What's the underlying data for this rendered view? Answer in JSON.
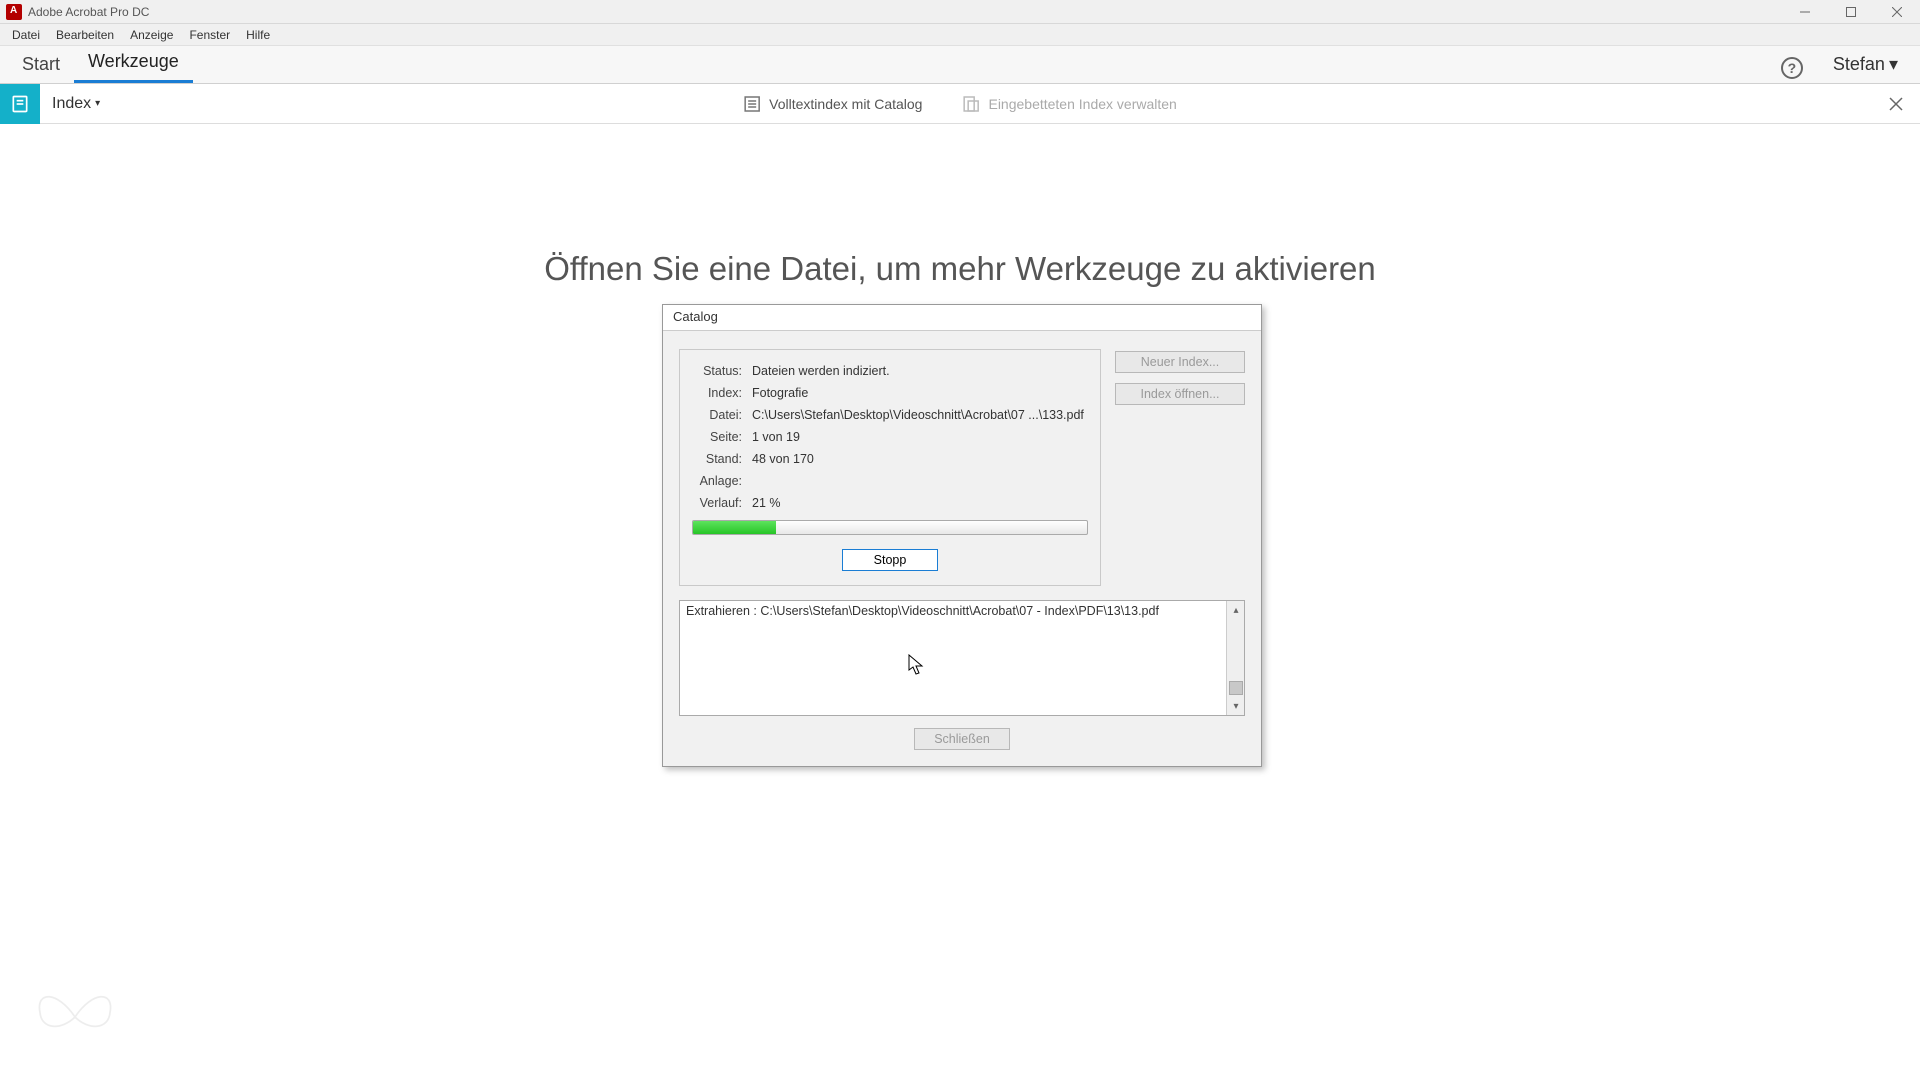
{
  "titlebar": {
    "app_title": "Adobe Acrobat Pro DC"
  },
  "menubar": {
    "items": [
      "Datei",
      "Bearbeiten",
      "Anzeige",
      "Fenster",
      "Hilfe"
    ]
  },
  "maintabs": {
    "start": "Start",
    "tools": "Werkzeuge",
    "user": "Stefan"
  },
  "toolbar": {
    "tool": "Index",
    "action1": "Volltextindex mit Catalog",
    "action2": "Eingebetteten Index verwalten"
  },
  "stage": {
    "heading": "Öffnen Sie eine Datei, um mehr Werkzeuge zu aktivieren"
  },
  "dialog": {
    "title": "Catalog",
    "labels": {
      "status": "Status:",
      "index": "Index:",
      "file": "Datei:",
      "page": "Seite:",
      "stand": "Stand:",
      "anlage": "Anlage:",
      "verlauf": "Verlauf:"
    },
    "values": {
      "status": "Dateien werden indiziert.",
      "index": "Fotografie",
      "file": "C:\\Users\\Stefan\\Desktop\\Videoschnitt\\Acrobat\\07 ...\\133.pdf",
      "page": "1 von 19",
      "stand": "48 von 170",
      "anlage": "",
      "verlauf": "21 %"
    },
    "progress_percent": 21,
    "buttons": {
      "stop": "Stopp",
      "new_index": "Neuer Index...",
      "open_index": "Index öffnen...",
      "close": "Schließen"
    },
    "log_line": "Extrahieren : C:\\Users\\Stefan\\Desktop\\Videoschnitt\\Acrobat\\07 - Index\\PDF\\13\\13.pdf"
  }
}
